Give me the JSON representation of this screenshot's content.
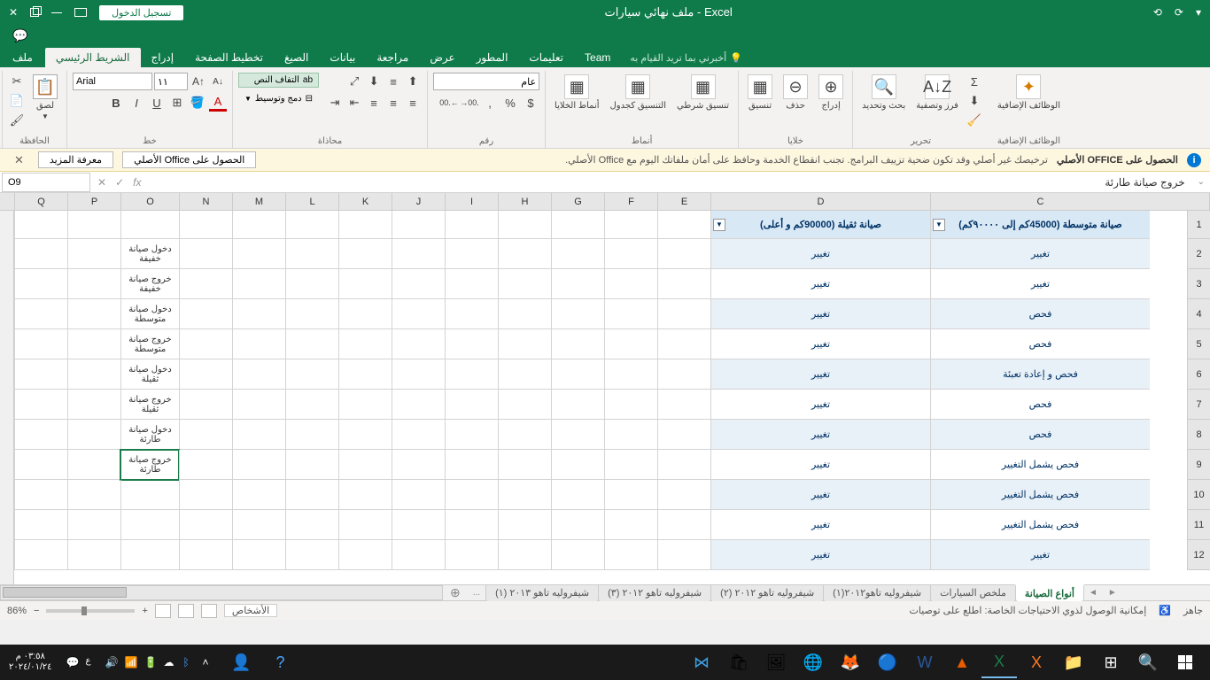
{
  "titlebar": {
    "title": "ملف نهائي سيارات - Excel",
    "login": "تسجيل الدخول"
  },
  "tabs": {
    "file": "ملف",
    "home": "الشريط الرئيسي",
    "insert": "إدراج",
    "pagelayout": "تخطيط الصفحة",
    "formulas": "الصيغ",
    "data": "بيانات",
    "review": "مراجعة",
    "view": "عرض",
    "developer": "المطور",
    "help": "تعليمات",
    "team": "Team",
    "tellme": "أخبرني بما تريد القيام به"
  },
  "ribbon": {
    "clipboard": {
      "label": "الحافظة",
      "paste": "لصق"
    },
    "font": {
      "label": "خط",
      "name": "Arial",
      "size": "١١"
    },
    "alignment": {
      "label": "محاذاة",
      "wrap": "التفاف النص",
      "merge": "دمج وتوسيط"
    },
    "number": {
      "label": "رقم",
      "format": "عام"
    },
    "styles": {
      "label": "أنماط",
      "cond": "تنسيق شرطي",
      "table": "التنسيق كجدول",
      "cell": "أنماط الخلايا"
    },
    "cells": {
      "label": "خلايا",
      "insert": "إدراج",
      "delete": "حذف",
      "format": "تنسيق"
    },
    "editing": {
      "label": "تحرير",
      "sort": "فرز وتصفية",
      "find": "بحث وتحديد"
    },
    "addins": {
      "label": "الوظائف الإضافية",
      "btn": "الوظائف الإضافية"
    }
  },
  "msgbar": {
    "title": "الحصول على OFFICE الأصلي",
    "text": "ترخيصك غير أصلي وقد تكون ضحية تزييف البرامج. تجنب انقطاع الخدمة وحافظ على أمان ملفاتك اليوم مع Office الأصلي.",
    "btn1": "الحصول على Office الأصلي",
    "btn2": "معرفة المزيد"
  },
  "namebox": "O9",
  "formula": "خروج صيانة طارئة",
  "columns": [
    "Q",
    "P",
    "O",
    "N",
    "M",
    "L",
    "K",
    "J",
    "I",
    "H",
    "G",
    "F",
    "E",
    "D",
    "C"
  ],
  "colWidths": {
    "C": 248,
    "D": 248,
    "default": 60,
    "O": 66
  },
  "headers": {
    "C": "صيانة متوسطة (45000كم إلى ٩٠٠٠٠كم)",
    "D": "صيانة ثقيلة (90000كم و أعلى)"
  },
  "rows": [
    {
      "n": 2,
      "C": "تغيير",
      "D": "تغيير",
      "O": "دخول صيانة خفيفة",
      "alt": false
    },
    {
      "n": 3,
      "C": "تغيير",
      "D": "تغيير",
      "O": "خروج صيانة خفيفة",
      "alt": true
    },
    {
      "n": 4,
      "C": "فحص",
      "D": "تغيير",
      "O": "دخول صيانة متوسطة",
      "alt": false
    },
    {
      "n": 5,
      "C": "فحص",
      "D": "تغيير",
      "O": "خروج صيانة متوسطة",
      "alt": true
    },
    {
      "n": 6,
      "C": "فحص و إعادة تعبئة",
      "D": "تغيير",
      "O": "دخول صيانة ثقيلة",
      "alt": false
    },
    {
      "n": 7,
      "C": "فحص",
      "D": "تغيير",
      "O": "خروج صيانة ثقيلة",
      "alt": true
    },
    {
      "n": 8,
      "C": "فحص",
      "D": "تغيير",
      "O": "دخول صيانة طارئة",
      "alt": false
    },
    {
      "n": 9,
      "C": "فحص يشمل التغيير",
      "D": "تغيير",
      "O": "خروج صيانة طارئة",
      "alt": true,
      "selected": true
    },
    {
      "n": 10,
      "C": "فحص يشمل التغيير",
      "D": "تغيير",
      "O": "",
      "alt": false
    },
    {
      "n": 11,
      "C": "فحص يشمل التغيير",
      "D": "تغيير",
      "O": "",
      "alt": true
    },
    {
      "n": 12,
      "C": "تغيير",
      "D": "تغيير",
      "O": "",
      "alt": false
    }
  ],
  "sheets": {
    "active": "أنواع الصيانة",
    "others": [
      "ملخص السيارات",
      "شيفروليه تاهو٢٠١٢(١)",
      "شيفروليه تاهو ٢٠١٢ (٢)",
      "شيفروليه تاهو ٢٠١٢ (٣)",
      "شيفروليه تاهو ٢٠١٣ (١)"
    ],
    "more": "...",
    "people": "الأشخاص"
  },
  "status": {
    "ready": "جاهز",
    "access": "إمكانية الوصول لذوي الاحتياجات الخاصة: اطلع على توصيات",
    "zoom": "86%"
  },
  "taskbar": {
    "time": "٠٣:٥٨ م",
    "date": "٢٠٢٤/٠١/٢٤"
  }
}
